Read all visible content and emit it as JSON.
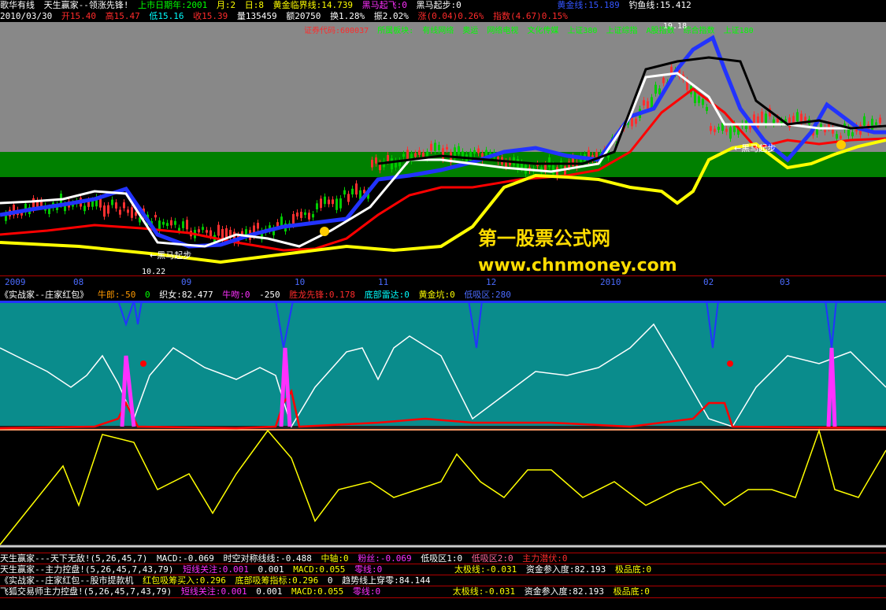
{
  "header": {
    "software": "歌华有线",
    "formula": "天生赢家--领涨先锋!",
    "ipo_year_label": "上市日期年:2001",
    "ipo_month_label": "月:2",
    "ipo_day_label": "日:8",
    "gold_line_label": "黄金临界线:14.739",
    "horse_fly_label": "黑马起飞:0",
    "horse_start_label": "黑马起步:0",
    "gold_label": "黄金线:15.189",
    "fish_label": "钓鱼线:15.412"
  },
  "quote": {
    "date": "2010/03/30",
    "open": "开15.40",
    "high": "高15.47",
    "low": "低15.16",
    "close": "收15.39",
    "volume": "量135459",
    "amount": "额20750",
    "turnover": "换1.28%",
    "amplitude": "振2.02%",
    "change": "涨(0.04)0.26%",
    "index": "指数(4.67)0.15%"
  },
  "info_bar": {
    "stock_code": "证券代码:600037",
    "tags": [
      "所属板块:",
      "有线网络",
      "奥运",
      "网络电视",
      "文化传媒",
      "上证380",
      "上证综指",
      "A股指数",
      "综合指数",
      "上证180"
    ]
  },
  "chart_labels": {
    "high_price": "19.18",
    "low_price": "10.22",
    "horse_label_1": "←黑马起步",
    "horse_label_2": "←黑马起步"
  },
  "date_axis": [
    "2009",
    "08",
    "09",
    "10",
    "11",
    "12",
    "2010",
    "02",
    "03"
  ],
  "ind1_header": {
    "title": "《实战家--庄家红包》",
    "bull": "牛郎:-50",
    "zero": "0",
    "weaver": "织女:82.477",
    "kiss": "牛吻:0",
    "neg": "-250",
    "dragon": "胜龙先锋:0.178",
    "radar": "底部雷达:0",
    "pit": "黄金坑:0",
    "low_absorb": "低吸区:280"
  },
  "footer": [
    {
      "name": "天生赢家---天下无敌!(5,26,45,7)",
      "parts": [
        "MACD:-0.069",
        "时空对称线线:-0.488",
        "中轴:0",
        "粉丝:-0.069",
        "低吸区1:0",
        "低吸区2:0",
        "主力潜伏:0"
      ]
    },
    {
      "name": "天生赢家--主力控盘!(5,26,45,7,43,79)",
      "parts": [
        "短线关注:0.001",
        "0.001",
        "MACD:0.055",
        "零线:0",
        "太极线:-0.031",
        "资金参入度:82.193",
        "极品底:0"
      ]
    },
    {
      "name": "《实战家--庄家红包--股市提款机",
      "parts": [
        "红包吸筹买入:0.296",
        "底部吸筹指标:0.296",
        "0",
        "趋势线上穿零:84.144"
      ]
    },
    {
      "name": "飞狐交易师主力控盘!(5,26,45,7,43,79)",
      "parts": [
        "短线关注:0.001",
        "0.001",
        "MACD:0.055",
        "零线:0",
        "太极线:-0.031",
        "资金参入度:82.193",
        "极品底:0"
      ]
    }
  ],
  "watermark": {
    "line1": "第一股票公式网",
    "line2": "www.chnmoney.com"
  },
  "colors": {
    "gray_zone": "#888888",
    "green_zone": "#008000",
    "teal_zone": "#0a8c8c",
    "blue_line": "#2233ff",
    "yellow_line": "#ffff00",
    "white_line": "#ffffff",
    "red_line": "#ff0000",
    "watermark": "#ffdd00"
  }
}
